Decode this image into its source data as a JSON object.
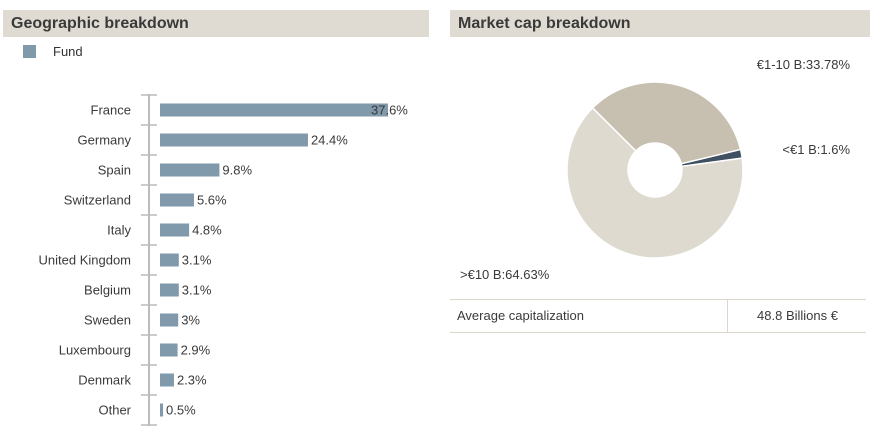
{
  "geographic": {
    "title": "Geographic breakdown",
    "legend_label": "Fund"
  },
  "market_cap": {
    "title": "Market cap breakdown",
    "table": {
      "label": "Average capitalization",
      "value": "48.8 Billions €"
    }
  },
  "colors": {
    "bar": "#8099ab",
    "header_bg": "#e0dbd2",
    "pie_large": "#dedad0",
    "pie_mid": "#c7c0b0",
    "pie_small": "#3f5060"
  },
  "chart_data": [
    {
      "type": "bar",
      "orientation": "horizontal",
      "title": "Geographic breakdown",
      "series": [
        {
          "name": "Fund",
          "values": [
            37.6,
            24.4,
            9.8,
            5.6,
            4.8,
            3.1,
            3.1,
            3,
            2.9,
            2.3,
            0.5
          ]
        }
      ],
      "categories": [
        "France",
        "Germany",
        "Spain",
        "Switzerland",
        "Italy",
        "United Kingdom",
        "Belgium",
        "Sweden",
        "Luxembourg",
        "Denmark",
        "Other"
      ],
      "value_labels": [
        "37.6%",
        "24.4%",
        "9.8%",
        "5.6%",
        "4.8%",
        "3.1%",
        "3.1%",
        "3%",
        "2.9%",
        "2.3%",
        "0.5%"
      ],
      "legend": "top-left"
    },
    {
      "type": "pie",
      "title": "Market cap breakdown",
      "donut": true,
      "slices": [
        {
          "label": ">€10 B:64.63%",
          "value": 64.63,
          "color": "#dedad0"
        },
        {
          "label": "€1-10 B:33.78%",
          "value": 33.78,
          "color": "#c7c0b0"
        },
        {
          "label": "<€1 B:1.6%",
          "value": 1.6,
          "color": "#3f5060"
        }
      ]
    }
  ]
}
